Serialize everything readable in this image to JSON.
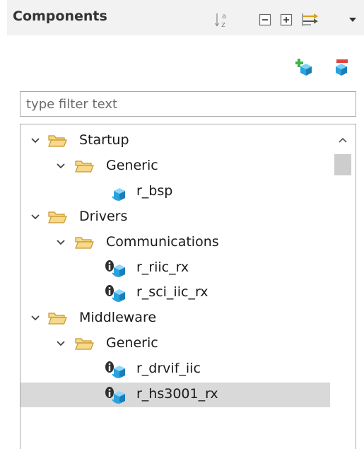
{
  "panel": {
    "title": "Components"
  },
  "header_icons": [
    "sort-alphabetical-icon",
    "collapse-all-icon",
    "expand-all-icon",
    "sync-arrows-icon",
    "view-menu-dropdown-icon"
  ],
  "toolbar_icons": [
    "add-component-icon",
    "remove-component-icon"
  ],
  "filter": {
    "placeholder": "type filter text",
    "value": ""
  },
  "tree": {
    "items": [
      {
        "label": "Startup",
        "level": 0,
        "kind": "folder",
        "expanded": true
      },
      {
        "label": "Generic",
        "level": 1,
        "kind": "folder",
        "expanded": true
      },
      {
        "label": "r_bsp",
        "level": 2,
        "kind": "component",
        "info_badge": false
      },
      {
        "label": "Drivers",
        "level": 0,
        "kind": "folder",
        "expanded": true
      },
      {
        "label": "Communications",
        "level": 1,
        "kind": "folder",
        "expanded": true
      },
      {
        "label": "r_riic_rx",
        "level": 2,
        "kind": "component",
        "info_badge": true
      },
      {
        "label": "r_sci_iic_rx",
        "level": 2,
        "kind": "component",
        "info_badge": true
      },
      {
        "label": "Middleware",
        "level": 0,
        "kind": "folder",
        "expanded": true
      },
      {
        "label": "Generic",
        "level": 1,
        "kind": "folder",
        "expanded": true
      },
      {
        "label": "r_drvif_iic",
        "level": 2,
        "kind": "component",
        "info_badge": true
      },
      {
        "label": "r_hs3001_rx",
        "level": 2,
        "kind": "component",
        "info_badge": true,
        "selected": true
      }
    ]
  },
  "colors": {
    "folder_fill": "#f6d98a",
    "folder_stroke": "#c8962e",
    "component_blue": "#29a3e0",
    "selection": "#d9d9d9",
    "add_green": "#3bb54a",
    "remove_red": "#e0453c"
  }
}
